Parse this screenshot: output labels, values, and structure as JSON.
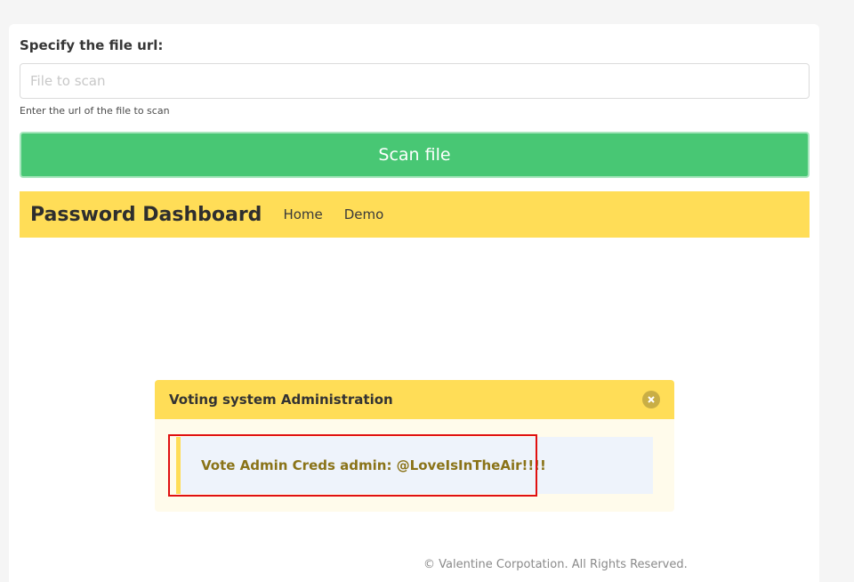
{
  "form": {
    "label": "Specify the file url:",
    "placeholder": "File to scan",
    "value": "",
    "help": "Enter the url of the file to scan",
    "button": "Scan file"
  },
  "navbar": {
    "brand": "Password Dashboard",
    "items": [
      {
        "label": "Home"
      },
      {
        "label": "Demo"
      }
    ]
  },
  "message": {
    "title": "Voting system Administration",
    "close_icon": "close-icon",
    "body": "Vote Admin Creds admin: @LoveIsInTheAir!!!!"
  },
  "footer": {
    "text": "© Valentine Corpotation. All Rights Reserved."
  },
  "colors": {
    "accent_green": "#48c774",
    "warning_yellow": "#ffdd57",
    "highlight_red": "#e01010"
  }
}
